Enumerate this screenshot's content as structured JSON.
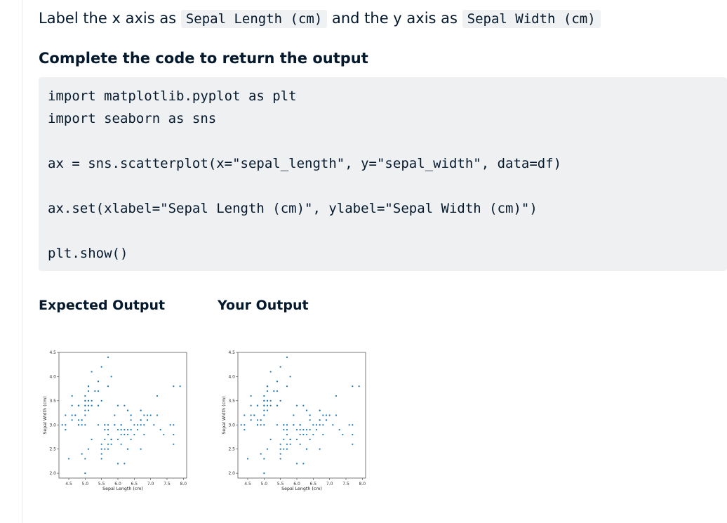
{
  "instruction": {
    "text_1": "Label the x axis as",
    "code_x": "Sepal Length (cm)",
    "text_2": "and the y axis as",
    "code_y": "Sepal Width (cm)"
  },
  "subheading": "Complete the code to return the output",
  "code_lines": [
    "import matplotlib.pyplot as plt",
    "import seaborn as sns",
    "",
    "ax = sns.scatterplot(x=\"sepal_length\", y=\"sepal_width\", data=df)",
    "",
    "ax.set(xlabel=\"Sepal Length (cm)\", ylabel=\"Sepal Width (cm)\")",
    "",
    "plt.show()"
  ],
  "outputs": {
    "expected_label": "Expected Output",
    "yours_label": "Your Output"
  },
  "colors": {
    "point": "#1f77b4",
    "code_bg": "#eff0f2",
    "text": "#05192d"
  },
  "chart_data": [
    {
      "type": "scatter",
      "panel": "expected",
      "xlabel": "Sepal Length (cm)",
      "ylabel": "Sepal Width (cm)",
      "xlim": [
        4.2,
        8.1
      ],
      "ylim": [
        1.9,
        4.5
      ],
      "xticks": [
        "4.5",
        "5.0",
        "5.5",
        "6.0",
        "6.5",
        "7.0",
        "7.5",
        "8.0"
      ],
      "yticks": [
        "2.0",
        "2.5",
        "3.0",
        "3.5",
        "4.0",
        "4.5"
      ],
      "points": [
        [
          5.1,
          3.5
        ],
        [
          4.9,
          3.0
        ],
        [
          4.7,
          3.2
        ],
        [
          4.6,
          3.1
        ],
        [
          5.0,
          3.6
        ],
        [
          5.4,
          3.9
        ],
        [
          4.6,
          3.4
        ],
        [
          5.0,
          3.4
        ],
        [
          4.4,
          2.9
        ],
        [
          4.9,
          3.1
        ],
        [
          5.4,
          3.7
        ],
        [
          4.8,
          3.4
        ],
        [
          4.8,
          3.0
        ],
        [
          4.3,
          3.0
        ],
        [
          5.8,
          4.0
        ],
        [
          5.7,
          4.4
        ],
        [
          5.4,
          3.9
        ],
        [
          5.1,
          3.5
        ],
        [
          5.7,
          3.8
        ],
        [
          5.1,
          3.8
        ],
        [
          5.4,
          3.4
        ],
        [
          5.1,
          3.7
        ],
        [
          4.6,
          3.6
        ],
        [
          5.1,
          3.3
        ],
        [
          4.8,
          3.4
        ],
        [
          5.0,
          3.0
        ],
        [
          5.0,
          3.4
        ],
        [
          5.2,
          3.5
        ],
        [
          5.2,
          3.4
        ],
        [
          4.7,
          3.2
        ],
        [
          4.8,
          3.1
        ],
        [
          5.4,
          3.4
        ],
        [
          5.2,
          4.1
        ],
        [
          5.5,
          4.2
        ],
        [
          4.9,
          3.1
        ],
        [
          5.0,
          3.2
        ],
        [
          5.5,
          3.5
        ],
        [
          4.4,
          3.0
        ],
        [
          5.1,
          3.4
        ],
        [
          5.0,
          3.5
        ],
        [
          4.5,
          2.3
        ],
        [
          4.4,
          3.2
        ],
        [
          5.0,
          3.5
        ],
        [
          5.1,
          3.8
        ],
        [
          4.8,
          3.0
        ],
        [
          5.1,
          3.8
        ],
        [
          4.6,
          3.2
        ],
        [
          5.3,
          3.7
        ],
        [
          5.0,
          3.3
        ],
        [
          7.0,
          3.2
        ],
        [
          6.4,
          3.2
        ],
        [
          6.9,
          3.1
        ],
        [
          5.5,
          2.3
        ],
        [
          6.5,
          2.8
        ],
        [
          5.7,
          2.8
        ],
        [
          6.3,
          3.3
        ],
        [
          4.9,
          2.4
        ],
        [
          6.6,
          2.9
        ],
        [
          5.2,
          2.7
        ],
        [
          5.0,
          2.0
        ],
        [
          5.9,
          3.0
        ],
        [
          6.0,
          2.2
        ],
        [
          6.1,
          2.9
        ],
        [
          5.6,
          2.9
        ],
        [
          6.7,
          3.1
        ],
        [
          5.6,
          3.0
        ],
        [
          5.8,
          2.7
        ],
        [
          6.2,
          2.2
        ],
        [
          5.6,
          2.5
        ],
        [
          5.9,
          3.2
        ],
        [
          6.1,
          2.8
        ],
        [
          6.3,
          2.5
        ],
        [
          6.4,
          2.9
        ],
        [
          6.6,
          3.0
        ],
        [
          6.8,
          2.8
        ],
        [
          6.7,
          3.0
        ],
        [
          6.0,
          2.9
        ],
        [
          5.7,
          2.6
        ],
        [
          5.5,
          2.4
        ],
        [
          5.8,
          2.7
        ],
        [
          6.0,
          2.7
        ],
        [
          5.4,
          3.0
        ],
        [
          6.0,
          3.4
        ],
        [
          6.7,
          3.1
        ],
        [
          5.6,
          3.0
        ],
        [
          5.5,
          2.5
        ],
        [
          5.5,
          2.6
        ],
        [
          6.1,
          3.0
        ],
        [
          5.8,
          2.6
        ],
        [
          5.0,
          2.3
        ],
        [
          5.6,
          2.7
        ],
        [
          5.7,
          3.0
        ],
        [
          5.7,
          2.9
        ],
        [
          6.2,
          2.9
        ],
        [
          5.1,
          2.5
        ],
        [
          6.3,
          3.3
        ],
        [
          5.8,
          2.7
        ],
        [
          7.1,
          3.0
        ],
        [
          6.3,
          2.9
        ],
        [
          6.5,
          3.0
        ],
        [
          7.6,
          3.0
        ],
        [
          7.3,
          2.9
        ],
        [
          6.7,
          2.5
        ],
        [
          7.2,
          3.6
        ],
        [
          6.4,
          2.7
        ],
        [
          6.8,
          3.0
        ],
        [
          5.7,
          2.5
        ],
        [
          6.4,
          3.2
        ],
        [
          7.7,
          3.8
        ],
        [
          7.7,
          2.6
        ],
        [
          6.9,
          3.2
        ],
        [
          7.7,
          2.8
        ],
        [
          6.7,
          3.3
        ],
        [
          7.2,
          3.2
        ],
        [
          6.2,
          2.8
        ],
        [
          6.1,
          3.0
        ],
        [
          7.4,
          2.8
        ],
        [
          7.9,
          3.8
        ],
        [
          6.3,
          2.8
        ],
        [
          6.1,
          2.6
        ],
        [
          7.7,
          3.0
        ],
        [
          6.4,
          3.1
        ],
        [
          6.9,
          3.1
        ],
        [
          5.8,
          2.7
        ],
        [
          6.8,
          3.2
        ],
        [
          6.7,
          3.3
        ],
        [
          6.3,
          2.5
        ],
        [
          6.2,
          3.4
        ],
        [
          5.9,
          3.0
        ]
      ]
    },
    {
      "type": "scatter",
      "panel": "yours",
      "xlabel": "Sepal Length (cm)",
      "ylabel": "Sepal Width (cm)",
      "xlim": [
        4.2,
        8.1
      ],
      "ylim": [
        1.9,
        4.5
      ],
      "xticks": [
        "4.5",
        "5.0",
        "5.5",
        "6.0",
        "6.5",
        "7.0",
        "7.5",
        "8.0"
      ],
      "yticks": [
        "2.0",
        "2.5",
        "3.0",
        "3.5",
        "4.0",
        "4.5"
      ],
      "points": [
        [
          5.1,
          3.5
        ],
        [
          4.9,
          3.0
        ],
        [
          4.7,
          3.2
        ],
        [
          4.6,
          3.1
        ],
        [
          5.0,
          3.6
        ],
        [
          5.4,
          3.9
        ],
        [
          4.6,
          3.4
        ],
        [
          5.0,
          3.4
        ],
        [
          4.4,
          2.9
        ],
        [
          4.9,
          3.1
        ],
        [
          5.4,
          3.7
        ],
        [
          4.8,
          3.4
        ],
        [
          4.8,
          3.0
        ],
        [
          4.3,
          3.0
        ],
        [
          5.8,
          4.0
        ],
        [
          5.7,
          4.4
        ],
        [
          5.4,
          3.9
        ],
        [
          5.1,
          3.5
        ],
        [
          5.7,
          3.8
        ],
        [
          5.1,
          3.8
        ],
        [
          5.4,
          3.4
        ],
        [
          5.1,
          3.7
        ],
        [
          4.6,
          3.6
        ],
        [
          5.1,
          3.3
        ],
        [
          4.8,
          3.4
        ],
        [
          5.0,
          3.0
        ],
        [
          5.0,
          3.4
        ],
        [
          5.2,
          3.5
        ],
        [
          5.2,
          3.4
        ],
        [
          4.7,
          3.2
        ],
        [
          4.8,
          3.1
        ],
        [
          5.4,
          3.4
        ],
        [
          5.2,
          4.1
        ],
        [
          5.5,
          4.2
        ],
        [
          4.9,
          3.1
        ],
        [
          5.0,
          3.2
        ],
        [
          5.5,
          3.5
        ],
        [
          4.4,
          3.0
        ],
        [
          5.1,
          3.4
        ],
        [
          5.0,
          3.5
        ],
        [
          4.5,
          2.3
        ],
        [
          4.4,
          3.2
        ],
        [
          5.0,
          3.5
        ],
        [
          5.1,
          3.8
        ],
        [
          4.8,
          3.0
        ],
        [
          5.1,
          3.8
        ],
        [
          4.6,
          3.2
        ],
        [
          5.3,
          3.7
        ],
        [
          5.0,
          3.3
        ],
        [
          7.0,
          3.2
        ],
        [
          6.4,
          3.2
        ],
        [
          6.9,
          3.1
        ],
        [
          5.5,
          2.3
        ],
        [
          6.5,
          2.8
        ],
        [
          5.7,
          2.8
        ],
        [
          6.3,
          3.3
        ],
        [
          4.9,
          2.4
        ],
        [
          6.6,
          2.9
        ],
        [
          5.2,
          2.7
        ],
        [
          5.0,
          2.0
        ],
        [
          5.9,
          3.0
        ],
        [
          6.0,
          2.2
        ],
        [
          6.1,
          2.9
        ],
        [
          5.6,
          2.9
        ],
        [
          6.7,
          3.1
        ],
        [
          5.6,
          3.0
        ],
        [
          5.8,
          2.7
        ],
        [
          6.2,
          2.2
        ],
        [
          5.6,
          2.5
        ],
        [
          5.9,
          3.2
        ],
        [
          6.1,
          2.8
        ],
        [
          6.3,
          2.5
        ],
        [
          6.4,
          2.9
        ],
        [
          6.6,
          3.0
        ],
        [
          6.8,
          2.8
        ],
        [
          6.7,
          3.0
        ],
        [
          6.0,
          2.9
        ],
        [
          5.7,
          2.6
        ],
        [
          5.5,
          2.4
        ],
        [
          5.8,
          2.7
        ],
        [
          6.0,
          2.7
        ],
        [
          5.4,
          3.0
        ],
        [
          6.0,
          3.4
        ],
        [
          6.7,
          3.1
        ],
        [
          5.6,
          3.0
        ],
        [
          5.5,
          2.5
        ],
        [
          5.5,
          2.6
        ],
        [
          6.1,
          3.0
        ],
        [
          5.8,
          2.6
        ],
        [
          5.0,
          2.3
        ],
        [
          5.6,
          2.7
        ],
        [
          5.7,
          3.0
        ],
        [
          5.7,
          2.9
        ],
        [
          6.2,
          2.9
        ],
        [
          5.1,
          2.5
        ],
        [
          6.3,
          3.3
        ],
        [
          5.8,
          2.7
        ],
        [
          7.1,
          3.0
        ],
        [
          6.3,
          2.9
        ],
        [
          6.5,
          3.0
        ],
        [
          7.6,
          3.0
        ],
        [
          7.3,
          2.9
        ],
        [
          6.7,
          2.5
        ],
        [
          7.2,
          3.6
        ],
        [
          6.4,
          2.7
        ],
        [
          6.8,
          3.0
        ],
        [
          5.7,
          2.5
        ],
        [
          6.4,
          3.2
        ],
        [
          7.7,
          3.8
        ],
        [
          7.7,
          2.6
        ],
        [
          6.9,
          3.2
        ],
        [
          7.7,
          2.8
        ],
        [
          6.7,
          3.3
        ],
        [
          7.2,
          3.2
        ],
        [
          6.2,
          2.8
        ],
        [
          6.1,
          3.0
        ],
        [
          7.4,
          2.8
        ],
        [
          7.9,
          3.8
        ],
        [
          6.3,
          2.8
        ],
        [
          6.1,
          2.6
        ],
        [
          7.7,
          3.0
        ],
        [
          6.4,
          3.1
        ],
        [
          6.9,
          3.1
        ],
        [
          5.8,
          2.7
        ],
        [
          6.8,
          3.2
        ],
        [
          6.7,
          3.3
        ],
        [
          6.3,
          2.5
        ],
        [
          6.2,
          3.4
        ],
        [
          5.9,
          3.0
        ]
      ]
    }
  ]
}
